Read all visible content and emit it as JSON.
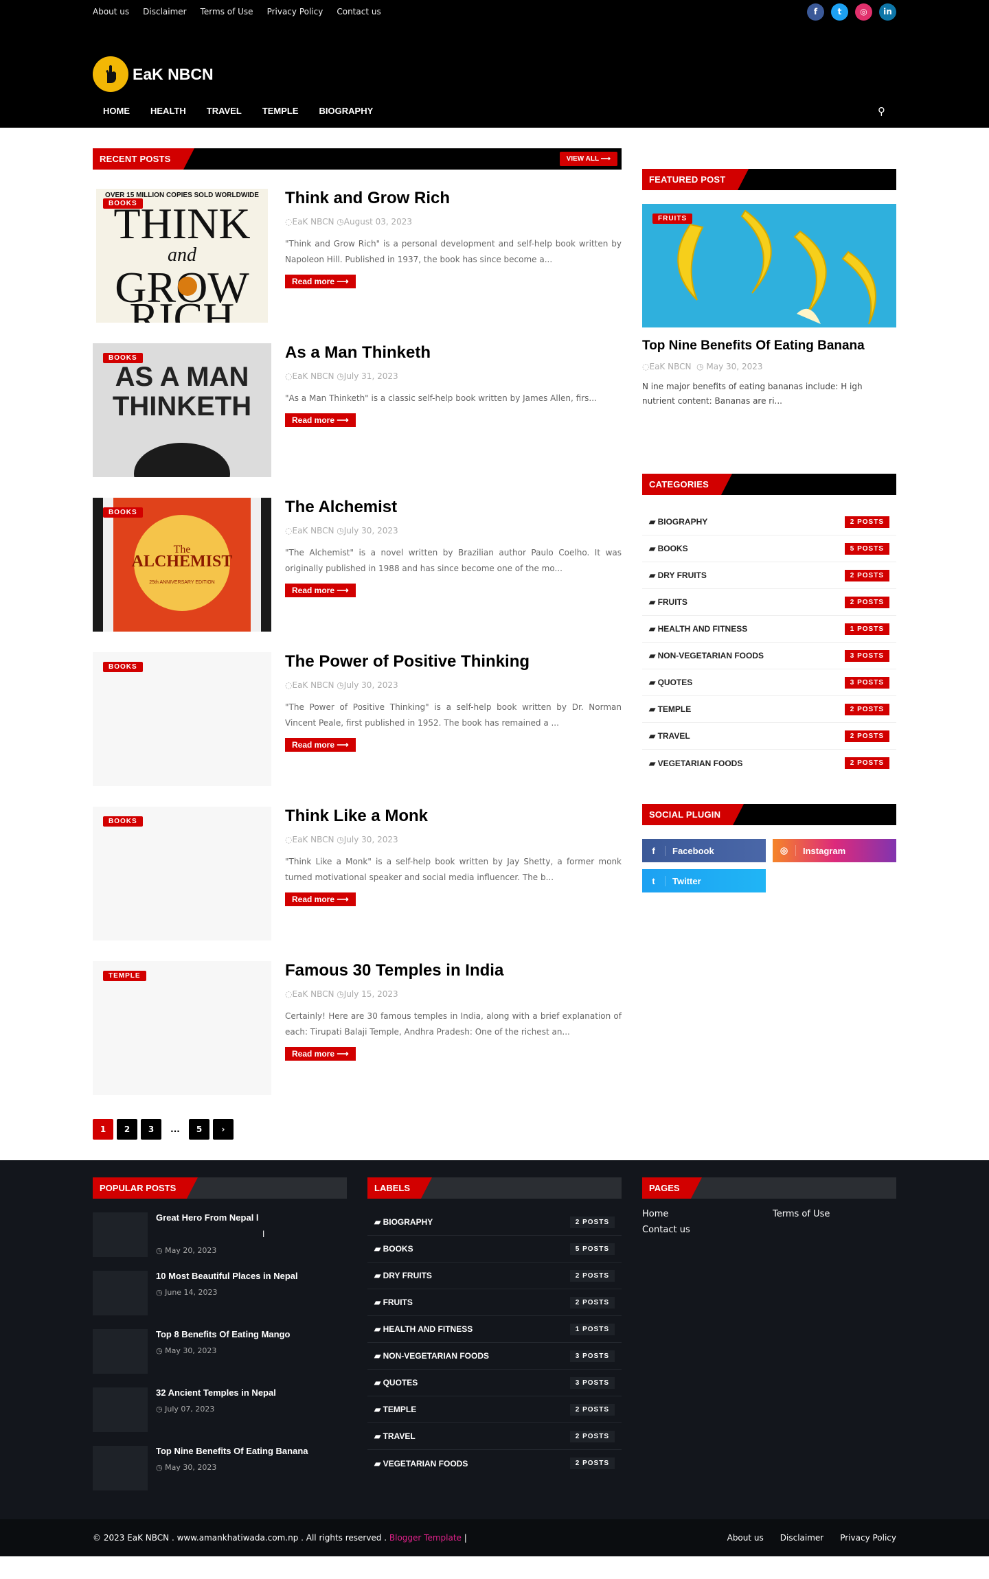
{
  "topbar": {
    "links": [
      "About us",
      "Disclaimer",
      "Terms of Use",
      "Privacy Policy",
      "Contact us"
    ],
    "socials": [
      {
        "name": "facebook-icon",
        "glyph": "f",
        "color": "#3b5998"
      },
      {
        "name": "twitter-icon",
        "glyph": "t",
        "color": "#1da1f2"
      },
      {
        "name": "instagram-icon",
        "glyph": "◎",
        "color": "#e1306c"
      },
      {
        "name": "linkedin-icon",
        "glyph": "in",
        "color": "#0e76a8"
      }
    ]
  },
  "header": {
    "logo_text": "EaK NBCN",
    "nav": [
      "HOME",
      "HEALTH",
      "TRAVEL",
      "TEMPLE",
      "BIOGRAPHY"
    ],
    "search_icon": "⚲"
  },
  "recent": {
    "title": "RECENT POSTS",
    "view_all": "VIEW ALL ⟶",
    "read_more": "Read more ⟶",
    "posts": [
      {
        "badge": "BOOKS",
        "title": "Think and Grow Rich",
        "author": "EaK NBCN",
        "date": "August 03, 2023",
        "excerpt": "\"Think and Grow Rich\" is a personal development and self-help book written by Napoleon Hill. Published in 1937, the book has since become a...",
        "thumb": "think"
      },
      {
        "badge": "BOOKS",
        "title": "As a Man Thinketh",
        "author": "EaK NBCN",
        "date": "July 31, 2023",
        "excerpt": "\"As a Man Thinketh\" is a classic self-help book written by James Allen, firs...",
        "thumb": "man"
      },
      {
        "badge": "BOOKS",
        "title": "The Alchemist",
        "author": "EaK NBCN",
        "date": "July 30, 2023",
        "excerpt": "\"The Alchemist\" is a novel written by Brazilian author Paulo Coelho. It was originally published in 1988 and has since become one of the mo...",
        "thumb": "alch"
      },
      {
        "badge": "BOOKS",
        "title": "The Power of Positive Thinking",
        "author": "EaK NBCN",
        "date": "July 30, 2023",
        "excerpt": "\"The Power of Positive Thinking\" is a self-help book written by Dr. Norman Vincent Peale, first published in 1952. The book has remained a ...",
        "thumb": ""
      },
      {
        "badge": "BOOKS",
        "title": "Think Like a Monk",
        "author": "EaK NBCN",
        "date": "July 30, 2023",
        "excerpt": "\"Think Like a Monk\" is a self-help book written by Jay Shetty, a former monk turned motivational speaker and social media influencer. The b...",
        "thumb": ""
      },
      {
        "badge": "TEMPLE",
        "title": "Famous 30 Temples in India",
        "author": "EaK NBCN",
        "date": "July 15, 2023",
        "excerpt": "Certainly! Here are 30 famous temples in India, along with a brief explanation of each: Tirupati Balaji Temple, Andhra Pradesh: One of the richest an...",
        "thumb": ""
      }
    ]
  },
  "thumb_text": {
    "think_top": "OVER 15 MILLION COPIES SOLD WORLDWIDE",
    "think_main": "THINK",
    "think_and": "and",
    "think_grow": "GROW",
    "think_rich": "RICH",
    "man_l1": "AS A MAN",
    "man_l2": "THINKETH",
    "alch_the": "The",
    "alch_main": "ALCHEMIST",
    "alch_ed": "25th ANNIVERSARY EDITION"
  },
  "pager": {
    "pages": [
      "1",
      "2",
      "3",
      "...",
      "5",
      "›"
    ]
  },
  "featured": {
    "title": "FEATURED POST",
    "badge": "FRUITS",
    "post_title": "Top Nine Benefits Of Eating Banana",
    "author": "EaK NBCN",
    "date": "May 30, 2023",
    "excerpt": "N ine major benefits of eating bananas include: H igh nutrient content: Bananas are ri..."
  },
  "categories": {
    "title": "CATEGORIES",
    "items": [
      {
        "label": "BIOGRAPHY",
        "count": "2 POSTS"
      },
      {
        "label": "BOOKS",
        "count": "5 POSTS"
      },
      {
        "label": "DRY FRUITS",
        "count": "2 POSTS"
      },
      {
        "label": "FRUITS",
        "count": "2 POSTS"
      },
      {
        "label": "HEALTH AND FITNESS",
        "count": "1 POSTS"
      },
      {
        "label": "NON-VEGETARIAN FOODS",
        "count": "3 POSTS"
      },
      {
        "label": "QUOTES",
        "count": "3 POSTS"
      },
      {
        "label": "TEMPLE",
        "count": "2 POSTS"
      },
      {
        "label": "TRAVEL",
        "count": "2 POSTS"
      },
      {
        "label": "VEGETARIAN FOODS",
        "count": "2 POSTS"
      }
    ]
  },
  "social_plugin": {
    "title": "SOCIAL PLUGIN",
    "buttons": [
      {
        "label": "Facebook",
        "glyph": "f",
        "bg": "linear-gradient(90deg,#3b5998,#4a67a8)"
      },
      {
        "label": "Instagram",
        "glyph": "◎",
        "bg": "linear-gradient(90deg,#f58529,#dd2a7b,#8134af)"
      },
      {
        "label": "Twitter",
        "glyph": "t",
        "bg": "linear-gradient(90deg,#1da1f2,#20b5f5)"
      }
    ]
  },
  "footer": {
    "popular_title": "POPULAR POSTS",
    "popular": [
      {
        "title": "Great Hero From Nepal l",
        "extra": "l",
        "date": "May 20, 2023"
      },
      {
        "title": "10 Most Beautiful Places in Nepal",
        "extra": "",
        "date": "June 14, 2023"
      },
      {
        "title": "Top 8 Benefits Of Eating Mango",
        "extra": "",
        "date": "May 30, 2023"
      },
      {
        "title": "32 Ancient Temples in Nepal",
        "extra": "",
        "date": "July 07, 2023"
      },
      {
        "title": "Top Nine Benefits Of Eating Banana",
        "extra": "",
        "date": "May 30, 2023"
      }
    ],
    "labels_title": "LABELS",
    "pages_title": "PAGES",
    "pages": [
      "Home",
      "Terms of Use",
      "Contact us"
    ]
  },
  "bottombar": {
    "copyright": "© 2023 EaK NBCN . www.amankhatiwada.com.np . All rights reserved .",
    "template_link": "Blogger Template",
    "sep": "|",
    "links": [
      "About us",
      "Disclaimer",
      "Privacy Policy"
    ]
  },
  "colors": {
    "accent": "#d20000",
    "dark": "#000000",
    "footer": "#13161c"
  }
}
